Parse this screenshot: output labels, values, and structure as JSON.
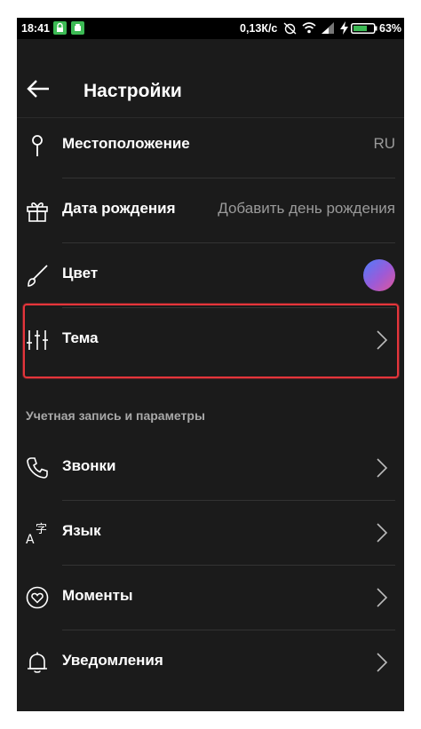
{
  "status_bar": {
    "time": "18:41",
    "net_speed": "0,13К/с",
    "battery": "63%",
    "icons": [
      "lock-icon",
      "android-icon",
      "alarm-off-icon",
      "wifi-icon",
      "signal-icon",
      "charging-icon",
      "battery-icon"
    ]
  },
  "header": {
    "title": "Настройки",
    "back_icon": "arrow-left-icon"
  },
  "profile_rows": [
    {
      "icon": "location-pin-icon",
      "label": "Местоположение",
      "value": "RU"
    },
    {
      "icon": "gift-icon",
      "label": "Дата рождения",
      "value": "Добавить день рождения"
    },
    {
      "icon": "brush-icon",
      "label": "Цвет",
      "value_color_swatch": true
    },
    {
      "icon": "sliders-icon",
      "label": "Тема",
      "chevron": true,
      "highlighted": true
    }
  ],
  "section_header": "Учетная запись и параметры",
  "account_rows": [
    {
      "icon": "phone-icon",
      "label": "Звонки"
    },
    {
      "icon": "translate-icon",
      "label": "Язык"
    },
    {
      "icon": "heart-circle-icon",
      "label": "Моменты"
    },
    {
      "icon": "bell-icon",
      "label": "Уведомления"
    }
  ],
  "colors": {
    "background": "#1b1b1b",
    "text_primary": "#ffffff",
    "text_secondary": "#9a9a9a",
    "highlight_border": "#e5353b"
  }
}
